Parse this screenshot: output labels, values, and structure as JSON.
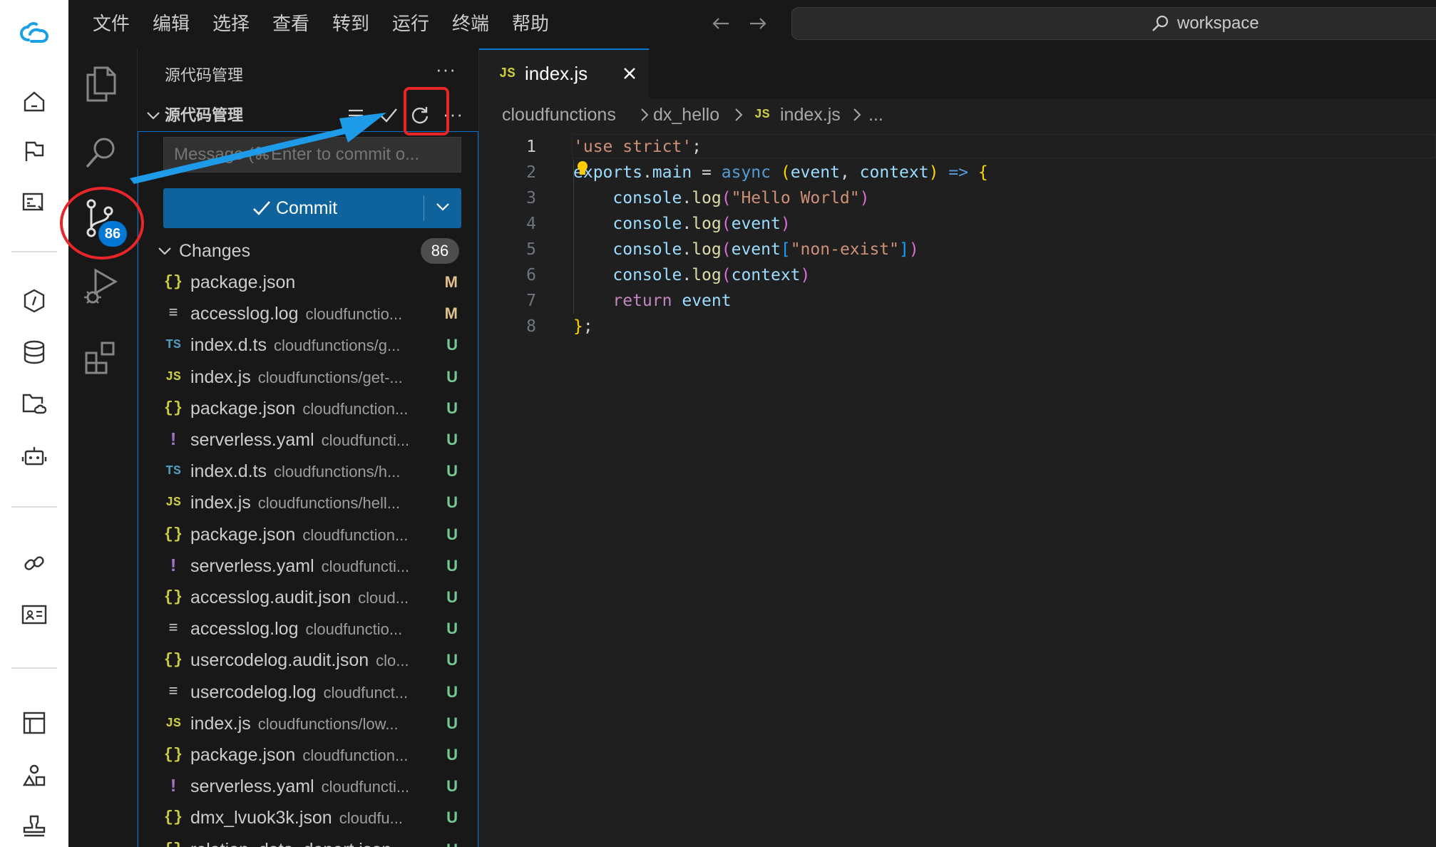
{
  "menu": [
    "文件",
    "编辑",
    "选择",
    "查看",
    "转到",
    "运行",
    "终端",
    "帮助"
  ],
  "search": {
    "text": "workspace"
  },
  "sidebar": {
    "title": "源代码管理",
    "section_title": "源代码管理",
    "commit_placeholder": "Message (⌘Enter to commit o...",
    "commit_label": "Commit",
    "changes_label": "Changes",
    "changes_count": "86",
    "files": [
      {
        "icon": "{}",
        "name": "package.json",
        "path": "",
        "status": "M"
      },
      {
        "icon": "≡",
        "name": "accesslog.log",
        "path": "cloudfunctio...",
        "status": "M"
      },
      {
        "icon": "TS",
        "name": "index.d.ts",
        "path": "cloudfunctions/g...",
        "status": "U"
      },
      {
        "icon": "JS",
        "name": "index.js",
        "path": "cloudfunctions/get-...",
        "status": "U"
      },
      {
        "icon": "{}",
        "name": "package.json",
        "path": "cloudfunction...",
        "status": "U"
      },
      {
        "icon": "!",
        "name": "serverless.yaml",
        "path": "cloudfuncti...",
        "status": "U"
      },
      {
        "icon": "TS",
        "name": "index.d.ts",
        "path": "cloudfunctions/h...",
        "status": "U"
      },
      {
        "icon": "JS",
        "name": "index.js",
        "path": "cloudfunctions/hell...",
        "status": "U"
      },
      {
        "icon": "{}",
        "name": "package.json",
        "path": "cloudfunction...",
        "status": "U"
      },
      {
        "icon": "!",
        "name": "serverless.yaml",
        "path": "cloudfuncti...",
        "status": "U"
      },
      {
        "icon": "{}",
        "name": "accesslog.audit.json",
        "path": "cloud...",
        "status": "U"
      },
      {
        "icon": "≡",
        "name": "accesslog.log",
        "path": "cloudfunctio...",
        "status": "U"
      },
      {
        "icon": "{}",
        "name": "usercodelog.audit.json",
        "path": "clo...",
        "status": "U"
      },
      {
        "icon": "≡",
        "name": "usercodelog.log",
        "path": "cloudfunct...",
        "status": "U"
      },
      {
        "icon": "JS",
        "name": "index.js",
        "path": "cloudfunctions/low...",
        "status": "U"
      },
      {
        "icon": "{}",
        "name": "package.json",
        "path": "cloudfunction...",
        "status": "U"
      },
      {
        "icon": "!",
        "name": "serverless.yaml",
        "path": "cloudfuncti...",
        "status": "U"
      },
      {
        "icon": "{}",
        "name": "dmx_lvuok3k.json",
        "path": "cloudfu...",
        "status": "U"
      },
      {
        "icon": "{}",
        "name": "relation_data_depart.json",
        "path": "",
        "status": "U"
      }
    ]
  },
  "activity": {
    "scm_badge": "86"
  },
  "editor": {
    "tab_icon": "JS",
    "tab_label": "index.js",
    "breadcrumb": {
      "part1": "cloudfunctions",
      "part2": "dx_hello",
      "file_icon": "JS",
      "part3": "index.js",
      "part4": "..."
    },
    "line_numbers": [
      "1",
      "2",
      "3",
      "4",
      "5",
      "6",
      "7",
      "8"
    ],
    "tokens": {
      "use_strict": "'use strict'",
      "exports": "exports",
      "main": "main",
      "async": "async",
      "event": "event",
      "context": "context",
      "console": "console",
      "log": "log",
      "hello": "\"Hello World\"",
      "nonexist": "\"non-exist\"",
      "return": "return"
    }
  },
  "colors": {
    "accent": "#0078d4",
    "commit_button": "#0e639c",
    "status_modified": "#e2c08d",
    "status_untracked": "#73c991",
    "annotation": "#e8262a",
    "arrow": "#1e9be8"
  }
}
